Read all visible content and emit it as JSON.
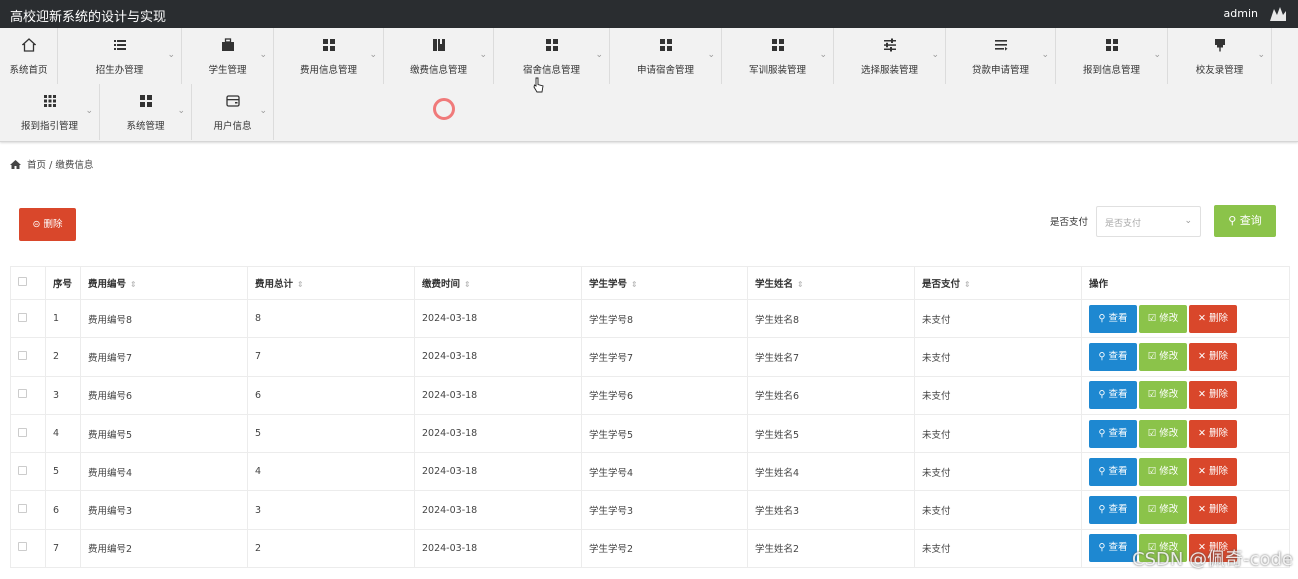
{
  "header": {
    "title": "高校迎新系统的设计与实现",
    "user": "admin"
  },
  "nav": [
    {
      "label": "系统首页",
      "icon": "home-icon",
      "chev": false
    },
    {
      "label": "招生办管理",
      "icon": "list-icon",
      "chev": true
    },
    {
      "label": "学生管理",
      "icon": "briefcase-icon",
      "chev": true
    },
    {
      "label": "费用信息管理",
      "icon": "grid-icon",
      "chev": true
    },
    {
      "label": "缴费信息管理",
      "icon": "book-icon",
      "chev": true
    },
    {
      "label": "宿舍信息管理",
      "icon": "grid-icon",
      "chev": true
    },
    {
      "label": "申请宿舍管理",
      "icon": "grid-icon",
      "chev": true
    },
    {
      "label": "军训服装管理",
      "icon": "grid-icon",
      "chev": true
    },
    {
      "label": "选择服装管理",
      "icon": "sliders-icon",
      "chev": true
    },
    {
      "label": "贷款申请管理",
      "icon": "list-lines-icon",
      "chev": true
    },
    {
      "label": "报到信息管理",
      "icon": "grid-icon",
      "chev": true
    },
    {
      "label": "校友录管理",
      "icon": "pin-icon",
      "chev": true
    },
    {
      "label": "报到指引管理",
      "icon": "grid9-icon",
      "chev": true
    },
    {
      "label": "系统管理",
      "icon": "grid-icon",
      "chev": true
    },
    {
      "label": "用户信息",
      "icon": "wallet-icon",
      "chev": true
    }
  ],
  "breadcrumb": {
    "home": "首页",
    "sep": "/",
    "current": "缴费信息"
  },
  "toolbar": {
    "delete_label": "删除",
    "filter_label": "是否支付",
    "filter_placeholder": "是否支付",
    "query_label": "查询"
  },
  "table": {
    "headers": [
      "",
      "序号",
      "费用编号",
      "费用总计",
      "缴费时间",
      "学生学号",
      "学生姓名",
      "是否支付",
      "操作"
    ],
    "rows": [
      [
        "1",
        "费用编号8",
        "8",
        "2024-03-18",
        "学生学号8",
        "学生姓名8",
        "未支付"
      ],
      [
        "2",
        "费用编号7",
        "7",
        "2024-03-18",
        "学生学号7",
        "学生姓名7",
        "未支付"
      ],
      [
        "3",
        "费用编号6",
        "6",
        "2024-03-18",
        "学生学号6",
        "学生姓名6",
        "未支付"
      ],
      [
        "4",
        "费用编号5",
        "5",
        "2024-03-18",
        "学生学号5",
        "学生姓名5",
        "未支付"
      ],
      [
        "5",
        "费用编号4",
        "4",
        "2024-03-18",
        "学生学号4",
        "学生姓名4",
        "未支付"
      ],
      [
        "6",
        "费用编号3",
        "3",
        "2024-03-18",
        "学生学号3",
        "学生姓名3",
        "未支付"
      ],
      [
        "7",
        "费用编号2",
        "2",
        "2024-03-18",
        "学生学号2",
        "学生姓名2",
        "未支付"
      ]
    ],
    "actions": {
      "view": "查看",
      "edit": "修改",
      "delete": "删除"
    }
  },
  "watermark": "CSDN @佩奇-code",
  "colors": {
    "topbar": "#2a2d30",
    "danger": "#d9472b",
    "success": "#8bc34a",
    "primary": "#1e88d1"
  }
}
